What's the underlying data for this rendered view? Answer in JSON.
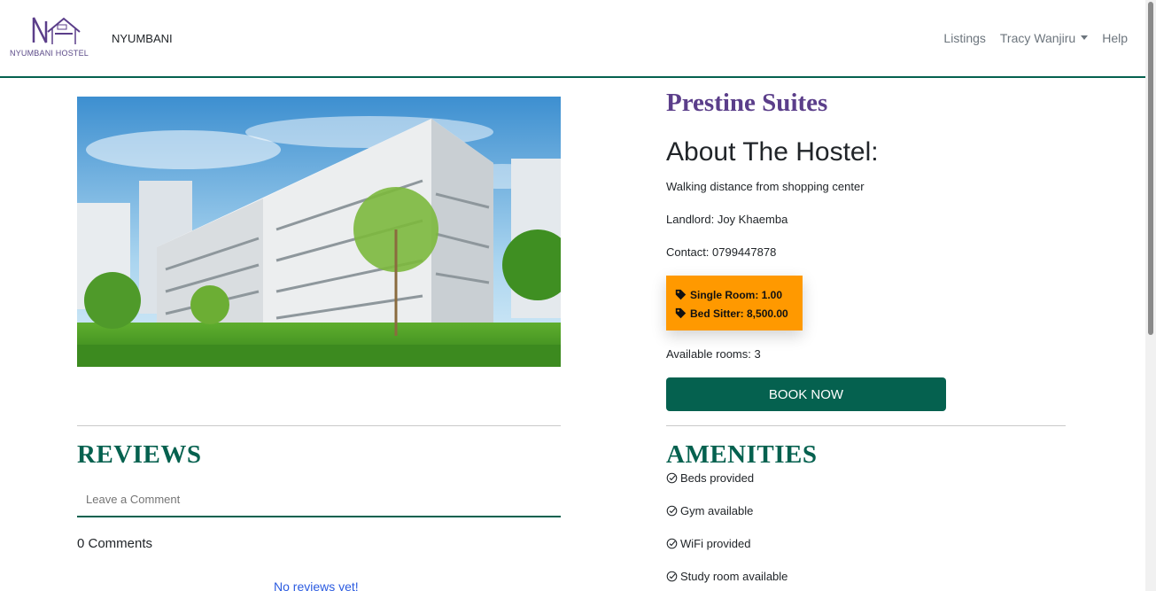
{
  "navbar": {
    "logo_text": "NYUMBANI HOSTEL",
    "brand": "NYUMBANI",
    "links": {
      "listings": "Listings",
      "user": "Tracy Wanjiru",
      "help": "Help"
    }
  },
  "hostel": {
    "name": "Prestine Suites",
    "about_title": "About The Hostel:",
    "description": "Walking distance from shopping center",
    "landlord": "Landlord: Joy Khaemba",
    "contact": "Contact: 0799447878",
    "prices": {
      "single_room": "Single Room: 1.00",
      "bed_sitter": "Bed Sitter: 8,500.00"
    },
    "available_rooms": "Available rooms: 3",
    "book_label": "BOOK NOW"
  },
  "reviews": {
    "title": "REVIEWS",
    "comment_placeholder": "Leave a Comment",
    "count_label": "0 Comments",
    "empty_text": "No reviews yet!"
  },
  "amenities": {
    "title": "AMENITIES",
    "items": [
      "Beds provided",
      "Gym available",
      "WiFi provided",
      "Study room available"
    ]
  },
  "colors": {
    "primary": "#05614f",
    "brand_purple": "#5b3e8a",
    "price_badge": "#ff9900",
    "link_blue": "#2b5be0"
  }
}
